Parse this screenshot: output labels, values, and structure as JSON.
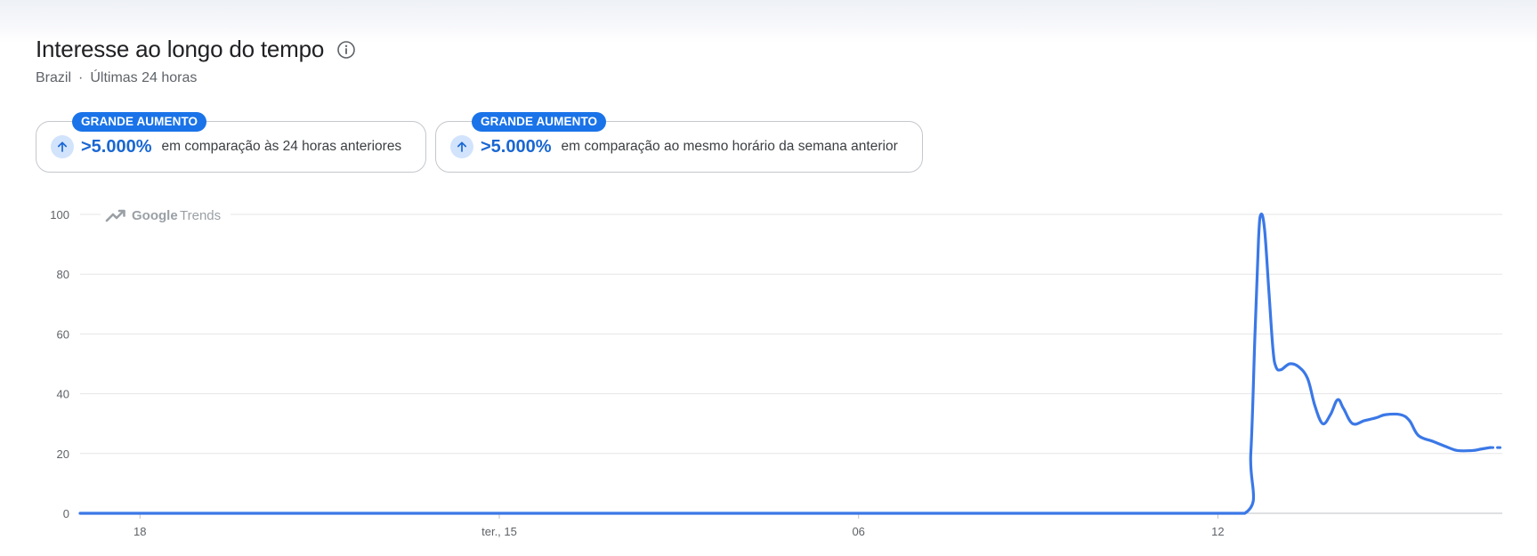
{
  "header": {
    "title": "Interesse ao longo do tempo",
    "location": "Brazil",
    "separator": "·",
    "period": "Últimas 24 horas"
  },
  "cards": [
    {
      "badge": "GRANDE AUMENTO",
      "value": ">5.000%",
      "description": "em comparação às 24 horas anteriores"
    },
    {
      "badge": "GRANDE AUMENTO",
      "value": ">5.000%",
      "description": "em comparação ao mesmo horário da semana anterior"
    }
  ],
  "watermark": {
    "brand": "Google",
    "product": "Trends"
  },
  "colors": {
    "accent": "#1a73e8",
    "line": "#3b78e7",
    "grid": "#e6e6e6"
  },
  "chart_data": {
    "type": "line",
    "ylim": [
      0,
      100
    ],
    "yticks": [
      0,
      20,
      40,
      60,
      80,
      100
    ],
    "xticks": [
      {
        "label": "18",
        "x": 1
      },
      {
        "label": "ter., 15",
        "x": 7
      },
      {
        "label": "06",
        "x": 13
      },
      {
        "label": "12",
        "x": 19
      }
    ],
    "xlim": [
      0,
      23.75
    ],
    "series": [
      {
        "points": [
          [
            0,
            0
          ],
          [
            2,
            0
          ],
          [
            4,
            0
          ],
          [
            6,
            0
          ],
          [
            8,
            0
          ],
          [
            10,
            0
          ],
          [
            12,
            0
          ],
          [
            14,
            0
          ],
          [
            16,
            0
          ],
          [
            18,
            0
          ],
          [
            19.45,
            0
          ],
          [
            19.55,
            20
          ],
          [
            19.62,
            60
          ],
          [
            19.68,
            92
          ],
          [
            19.72,
            100
          ],
          [
            19.78,
            95
          ],
          [
            19.85,
            75
          ],
          [
            19.92,
            55
          ],
          [
            19.97,
            49
          ],
          [
            20.05,
            48
          ],
          [
            20.2,
            50
          ],
          [
            20.35,
            49
          ],
          [
            20.5,
            45
          ],
          [
            20.62,
            36
          ],
          [
            20.75,
            30
          ],
          [
            20.88,
            33
          ],
          [
            21.0,
            38
          ],
          [
            21.1,
            35
          ],
          [
            21.25,
            30
          ],
          [
            21.45,
            31
          ],
          [
            21.65,
            32
          ],
          [
            21.8,
            33
          ],
          [
            22.05,
            33
          ],
          [
            22.2,
            31
          ],
          [
            22.35,
            26
          ],
          [
            22.6,
            24
          ],
          [
            22.85,
            22
          ],
          [
            23.0,
            21
          ],
          [
            23.25,
            21
          ],
          [
            23.4,
            21.5
          ],
          [
            23.55,
            22
          ]
        ],
        "partial": [
          [
            23.55,
            22
          ],
          [
            23.75,
            22
          ]
        ]
      }
    ]
  }
}
